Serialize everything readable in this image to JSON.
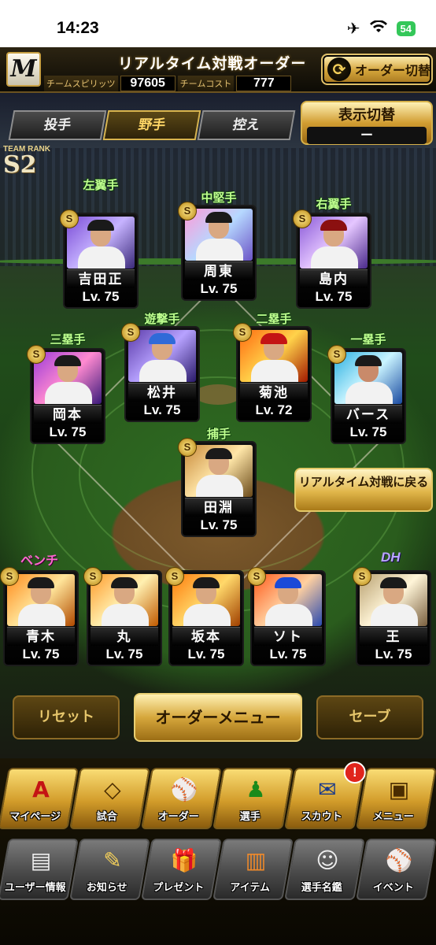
{
  "status_bar": {
    "time": "14:23",
    "battery": "54"
  },
  "header": {
    "logo": "M",
    "title": "リアルタイム対戦オーダー",
    "team_spirit_label": "チームスピリッツ",
    "team_spirit_value": "97605",
    "team_cost_label": "チームコスト",
    "team_cost_value": "777",
    "switch_order_label": "オーダー切替"
  },
  "tabs": [
    {
      "label": "投手",
      "active": false
    },
    {
      "label": "野手",
      "active": true
    },
    {
      "label": "控え",
      "active": false
    }
  ],
  "display_toggle": {
    "label": "表示切替",
    "value": "ー"
  },
  "team_rank": {
    "label": "TEAM RANK",
    "rank": "S2"
  },
  "positions": {
    "lf": {
      "pos": "左翼手",
      "name": "吉田正",
      "level": "Lv. 75",
      "badge": "S"
    },
    "cf": {
      "pos": "中堅手",
      "name": "周東",
      "level": "Lv. 75",
      "badge": "S"
    },
    "rf": {
      "pos": "右翼手",
      "name": "島内",
      "level": "Lv. 75",
      "badge": "S"
    },
    "ss": {
      "pos": "遊撃手",
      "name": "松井",
      "level": "Lv. 75",
      "badge": "S"
    },
    "b2": {
      "pos": "二塁手",
      "name": "菊池",
      "level": "Lv. 72",
      "badge": "S"
    },
    "b3": {
      "pos": "三塁手",
      "name": "岡本",
      "level": "Lv. 75",
      "badge": "S"
    },
    "b1": {
      "pos": "一塁手",
      "name": "バース",
      "level": "Lv. 75",
      "badge": "S"
    },
    "c": {
      "pos": "捕手",
      "name": "田淵",
      "level": "Lv. 75",
      "badge": "S"
    }
  },
  "back_to_battle": "リアルタイム対戦に戻る",
  "bench_label": "ベンチ",
  "dh_label": "DH",
  "bench": [
    {
      "name": "青木",
      "level": "Lv. 75",
      "badge": "S"
    },
    {
      "name": "丸",
      "level": "Lv. 75",
      "badge": "S"
    },
    {
      "name": "坂本",
      "level": "Lv. 75",
      "badge": "S"
    },
    {
      "name": "ソト",
      "level": "Lv. 75",
      "badge": "S"
    },
    {
      "name": "王",
      "level": "Lv. 75",
      "badge": "S"
    }
  ],
  "actions": {
    "reset": "リセット",
    "order_menu": "オーダーメニュー",
    "save": "セーブ"
  },
  "menu_main": [
    {
      "label": "マイページ",
      "icon": "A"
    },
    {
      "label": "試合",
      "icon": "◇"
    },
    {
      "label": "オーダー",
      "icon": "⚾"
    },
    {
      "label": "選手",
      "icon": "♟"
    },
    {
      "label": "スカウト",
      "icon": "✉",
      "alert": "!"
    },
    {
      "label": "メニュー",
      "icon": "▣"
    }
  ],
  "menu_sub": [
    {
      "label": "ユーザー情報",
      "icon": "▤"
    },
    {
      "label": "お知らせ",
      "icon": "✎"
    },
    {
      "label": "プレゼント",
      "icon": "🎁"
    },
    {
      "label": "アイテム",
      "icon": "▥"
    },
    {
      "label": "選手名鑑",
      "icon": "☺"
    },
    {
      "label": "イベント",
      "icon": "⚾"
    }
  ]
}
